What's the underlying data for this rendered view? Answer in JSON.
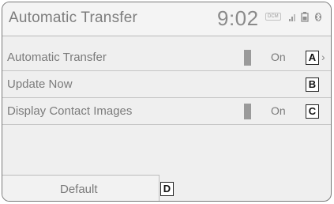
{
  "header": {
    "title": "Automatic Transfer",
    "clock": "9:02",
    "dcm_badge": "DCM",
    "icons": [
      "signal-icon",
      "battery-icon",
      "bluetooth-icon"
    ]
  },
  "settings": [
    {
      "label": "Automatic Transfer",
      "value": "On",
      "callout": "A"
    },
    {
      "label": "Update Now",
      "value": "",
      "callout": "B"
    },
    {
      "label": "Display Contact Images",
      "value": "On",
      "callout": "C"
    }
  ],
  "scroll_mark": "›",
  "default_button": {
    "label": "Default",
    "callout": "D"
  }
}
